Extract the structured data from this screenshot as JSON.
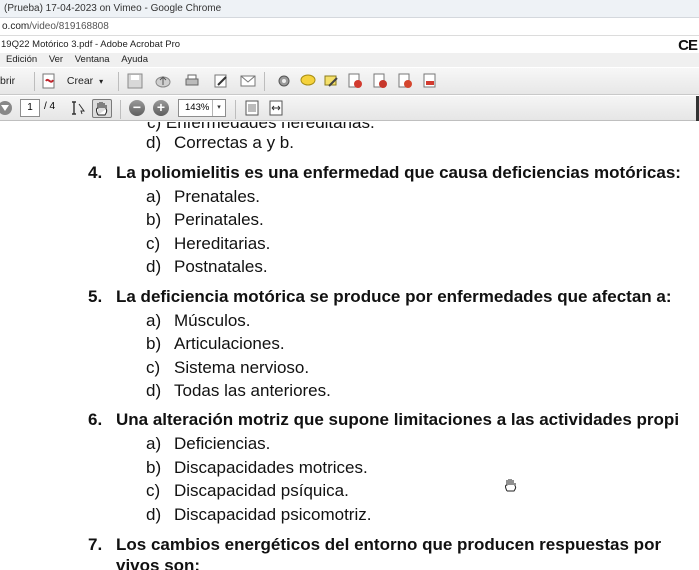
{
  "chrome": {
    "title": "(Prueba) 17-04-2023 on Vimeo - Google Chrome",
    "url_host": "o.com",
    "url_path": "/video/819168808"
  },
  "acrobat": {
    "title": "19Q22 Motórico 3.pdf - Adobe Acrobat Pro",
    "logo": "CE"
  },
  "menu": [
    "Edición",
    "Ver",
    "Ventana",
    "Ayuda"
  ],
  "toolbar": {
    "open_label": "brir",
    "create_label": "Crear",
    "create_caret": "▾"
  },
  "nav": {
    "current_page": "1",
    "page_total": "/ 4",
    "zoom": "143%",
    "zoom_caret": "▾"
  },
  "document": {
    "cut_top_line": "c)   Enfermedades hereditarias.",
    "items": [
      {
        "type": "opt",
        "letter": "d)",
        "text": "Correctas a y b."
      },
      {
        "type": "q",
        "num": "4.",
        "text": "La poliomielitis es una enfermedad que causa deficiencias motóricas:"
      },
      {
        "type": "opt",
        "letter": "a)",
        "text": "Prenatales."
      },
      {
        "type": "opt",
        "letter": "b)",
        "text": "Perinatales."
      },
      {
        "type": "opt",
        "letter": "c)",
        "text": "Hereditarias."
      },
      {
        "type": "opt",
        "letter": "d)",
        "text": "Postnatales."
      },
      {
        "type": "q",
        "num": "5.",
        "text": "La deficiencia motórica se produce por enfermedades que afectan a:"
      },
      {
        "type": "opt",
        "letter": "a)",
        "text": "Músculos."
      },
      {
        "type": "opt",
        "letter": "b)",
        "text": "Articulaciones."
      },
      {
        "type": "opt",
        "letter": "c)",
        "text": "Sistema nervioso."
      },
      {
        "type": "opt",
        "letter": "d)",
        "text": "Todas las anteriores."
      },
      {
        "type": "q",
        "num": "6.",
        "text": "Una alteración motriz que supone limitaciones a las actividades propi"
      },
      {
        "type": "opt",
        "letter": "a)",
        "text": "Deficiencias."
      },
      {
        "type": "opt",
        "letter": "b)",
        "text": "Discapacidades motrices."
      },
      {
        "type": "opt",
        "letter": "c)",
        "text": "Discapacidad psíquica."
      },
      {
        "type": "opt",
        "letter": "d)",
        "text": "Discapacidad psicomotriz."
      },
      {
        "type": "q",
        "num": "7.",
        "text": "Los cambios energéticos del entorno que producen respuestas por"
      },
      {
        "type": "q",
        "num": "",
        "text": "vivos son:"
      }
    ]
  }
}
